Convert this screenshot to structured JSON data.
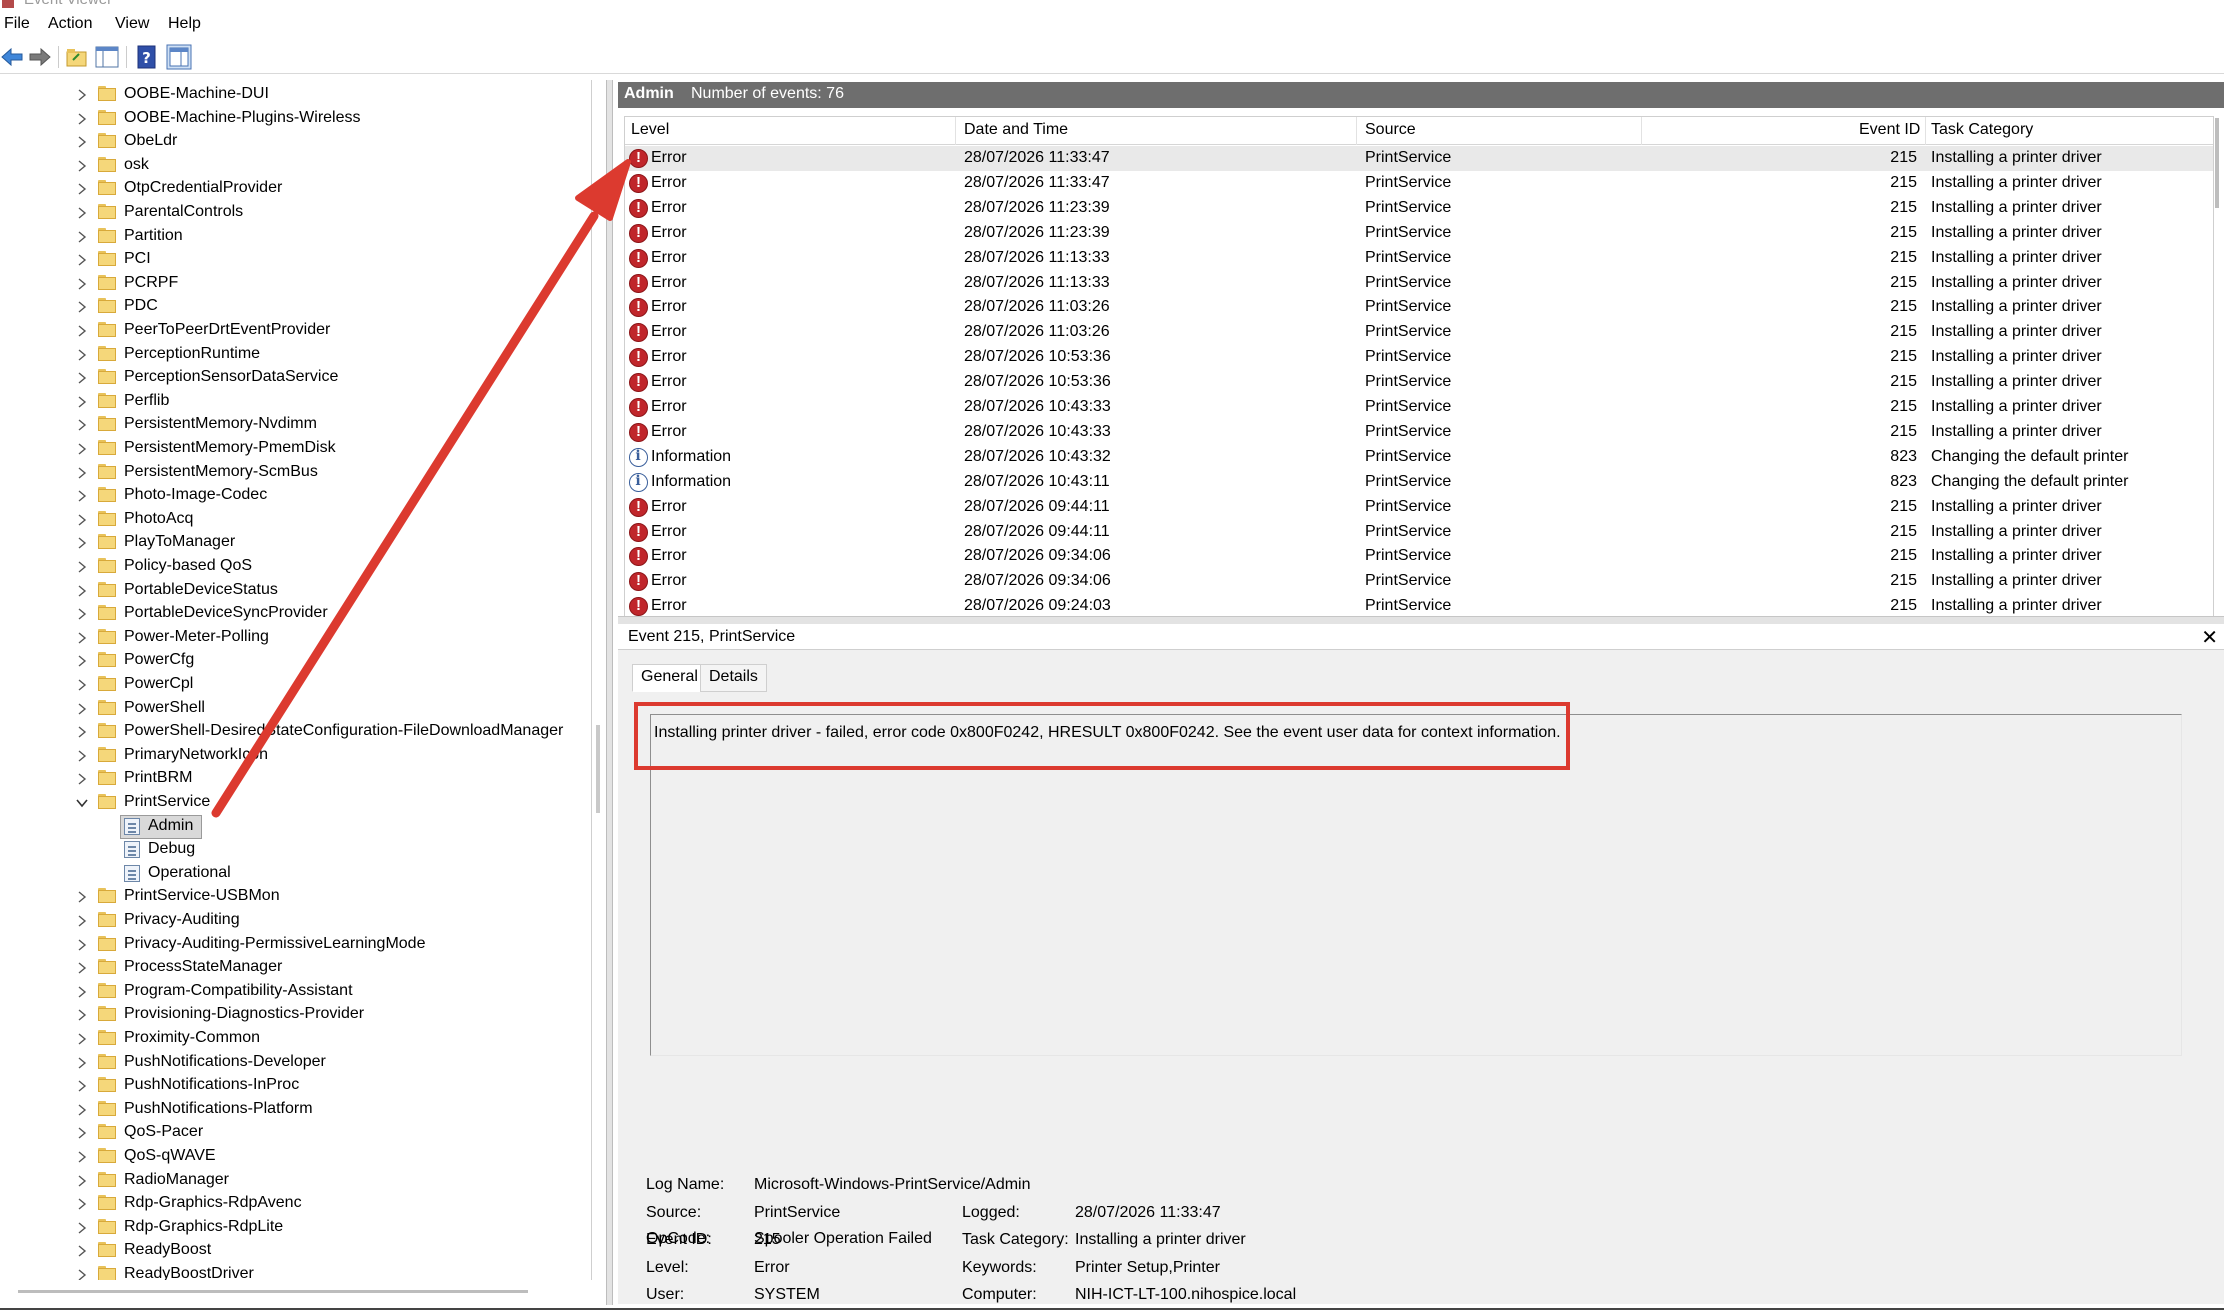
{
  "window": {
    "title": "Event Viewer"
  },
  "menu": [
    "File",
    "Action",
    "View",
    "Help"
  ],
  "tree": {
    "items": [
      {
        "label": "OOBE-Machine-DUI"
      },
      {
        "label": "OOBE-Machine-Plugins-Wireless"
      },
      {
        "label": "ObeLdr"
      },
      {
        "label": "osk"
      },
      {
        "label": "OtpCredentialProvider"
      },
      {
        "label": "ParentalControls"
      },
      {
        "label": "Partition"
      },
      {
        "label": "PCI"
      },
      {
        "label": "PCRPF"
      },
      {
        "label": "PDC"
      },
      {
        "label": "PeerToPeerDrtEventProvider"
      },
      {
        "label": "PerceptionRuntime"
      },
      {
        "label": "PerceptionSensorDataService"
      },
      {
        "label": "Perflib"
      },
      {
        "label": "PersistentMemory-Nvdimm"
      },
      {
        "label": "PersistentMemory-PmemDisk"
      },
      {
        "label": "PersistentMemory-ScmBus"
      },
      {
        "label": "Photo-Image-Codec"
      },
      {
        "label": "PhotoAcq"
      },
      {
        "label": "PlayToManager"
      },
      {
        "label": "Policy-based QoS"
      },
      {
        "label": "PortableDeviceStatus"
      },
      {
        "label": "PortableDeviceSyncProvider"
      },
      {
        "label": "Power-Meter-Polling"
      },
      {
        "label": "PowerCfg"
      },
      {
        "label": "PowerCpl"
      },
      {
        "label": "PowerShell"
      },
      {
        "label": "PowerShell-DesiredStateConfiguration-FileDownloadManager"
      },
      {
        "label": "PrimaryNetworkIcon"
      },
      {
        "label": "PrintBRM"
      },
      {
        "label": "PrintService"
      }
    ],
    "printservice_children": [
      "Admin",
      "Debug",
      "Operational"
    ],
    "items_after": [
      {
        "label": "PrintService-USBMon"
      },
      {
        "label": "Privacy-Auditing"
      },
      {
        "label": "Privacy-Auditing-PermissiveLearningMode"
      },
      {
        "label": "ProcessStateManager"
      },
      {
        "label": "Program-Compatibility-Assistant"
      },
      {
        "label": "Provisioning-Diagnostics-Provider"
      },
      {
        "label": "Proximity-Common"
      },
      {
        "label": "PushNotifications-Developer"
      },
      {
        "label": "PushNotifications-InProc"
      },
      {
        "label": "PushNotifications-Platform"
      },
      {
        "label": "QoS-Pacer"
      },
      {
        "label": "QoS-qWAVE"
      },
      {
        "label": "RadioManager"
      },
      {
        "label": "Rdp-Graphics-RdpAvenc"
      },
      {
        "label": "Rdp-Graphics-RdpLite"
      },
      {
        "label": "ReadyBoost"
      },
      {
        "label": "ReadyBoostDriver"
      }
    ]
  },
  "log": {
    "name": "Admin",
    "count_text": "Number of events: 76"
  },
  "columns": [
    "Level",
    "Date and Time",
    "Source",
    "Event ID",
    "Task Category"
  ],
  "events": [
    {
      "level": "Error",
      "time": "28/07/2026 11:33:47",
      "source": "PrintService",
      "id": "215",
      "task": "Installing a printer driver"
    },
    {
      "level": "Error",
      "time": "28/07/2026 11:33:47",
      "source": "PrintService",
      "id": "215",
      "task": "Installing a printer driver"
    },
    {
      "level": "Error",
      "time": "28/07/2026 11:23:39",
      "source": "PrintService",
      "id": "215",
      "task": "Installing a printer driver"
    },
    {
      "level": "Error",
      "time": "28/07/2026 11:23:39",
      "source": "PrintService",
      "id": "215",
      "task": "Installing a printer driver"
    },
    {
      "level": "Error",
      "time": "28/07/2026 11:13:33",
      "source": "PrintService",
      "id": "215",
      "task": "Installing a printer driver"
    },
    {
      "level": "Error",
      "time": "28/07/2026 11:13:33",
      "source": "PrintService",
      "id": "215",
      "task": "Installing a printer driver"
    },
    {
      "level": "Error",
      "time": "28/07/2026 11:03:26",
      "source": "PrintService",
      "id": "215",
      "task": "Installing a printer driver"
    },
    {
      "level": "Error",
      "time": "28/07/2026 11:03:26",
      "source": "PrintService",
      "id": "215",
      "task": "Installing a printer driver"
    },
    {
      "level": "Error",
      "time": "28/07/2026 10:53:36",
      "source": "PrintService",
      "id": "215",
      "task": "Installing a printer driver"
    },
    {
      "level": "Error",
      "time": "28/07/2026 10:53:36",
      "source": "PrintService",
      "id": "215",
      "task": "Installing a printer driver"
    },
    {
      "level": "Error",
      "time": "28/07/2026 10:43:33",
      "source": "PrintService",
      "id": "215",
      "task": "Installing a printer driver"
    },
    {
      "level": "Error",
      "time": "28/07/2026 10:43:33",
      "source": "PrintService",
      "id": "215",
      "task": "Installing a printer driver"
    },
    {
      "level": "Information",
      "time": "28/07/2026 10:43:32",
      "source": "PrintService",
      "id": "823",
      "task": "Changing the default printer"
    },
    {
      "level": "Information",
      "time": "28/07/2026 10:43:11",
      "source": "PrintService",
      "id": "823",
      "task": "Changing the default printer"
    },
    {
      "level": "Error",
      "time": "28/07/2026 09:44:11",
      "source": "PrintService",
      "id": "215",
      "task": "Installing a printer driver"
    },
    {
      "level": "Error",
      "time": "28/07/2026 09:44:11",
      "source": "PrintService",
      "id": "215",
      "task": "Installing a printer driver"
    },
    {
      "level": "Error",
      "time": "28/07/2026 09:34:06",
      "source": "PrintService",
      "id": "215",
      "task": "Installing a printer driver"
    },
    {
      "level": "Error",
      "time": "28/07/2026 09:34:06",
      "source": "PrintService",
      "id": "215",
      "task": "Installing a printer driver"
    },
    {
      "level": "Error",
      "time": "28/07/2026 09:24:03",
      "source": "PrintService",
      "id": "215",
      "task": "Installing a printer driver"
    }
  ],
  "detail": {
    "title": "Event 215, PrintService",
    "tabs": [
      "General",
      "Details"
    ],
    "description": "Installing printer driver - failed, error code 0x800F0242, HRESULT 0x800F0242. See the event user data for context information.",
    "props": {
      "log_name_label": "Log Name:",
      "log_name": "Microsoft-Windows-PrintService/Admin",
      "source_label": "Source:",
      "source": "PrintService",
      "logged_label": "Logged:",
      "logged": "28/07/2026 11:33:47",
      "event_id_label": "Event ID:",
      "event_id": "215",
      "task_label": "Task Category:",
      "task": "Installing a printer driver",
      "level_label": "Level:",
      "level": "Error",
      "keywords_label": "Keywords:",
      "keywords": "Printer Setup,Printer",
      "user_label": "User:",
      "user": "SYSTEM",
      "computer_label": "Computer:",
      "computer": "NIH-ICT-LT-100.nihospice.local",
      "opcode_label": "OpCode:",
      "opcode": "Spooler Operation Failed"
    }
  },
  "colors": {
    "annotation": "#dc3a2f",
    "error": "#c0262b",
    "info": "#3a5f9b",
    "header": "#6e6e6e"
  }
}
